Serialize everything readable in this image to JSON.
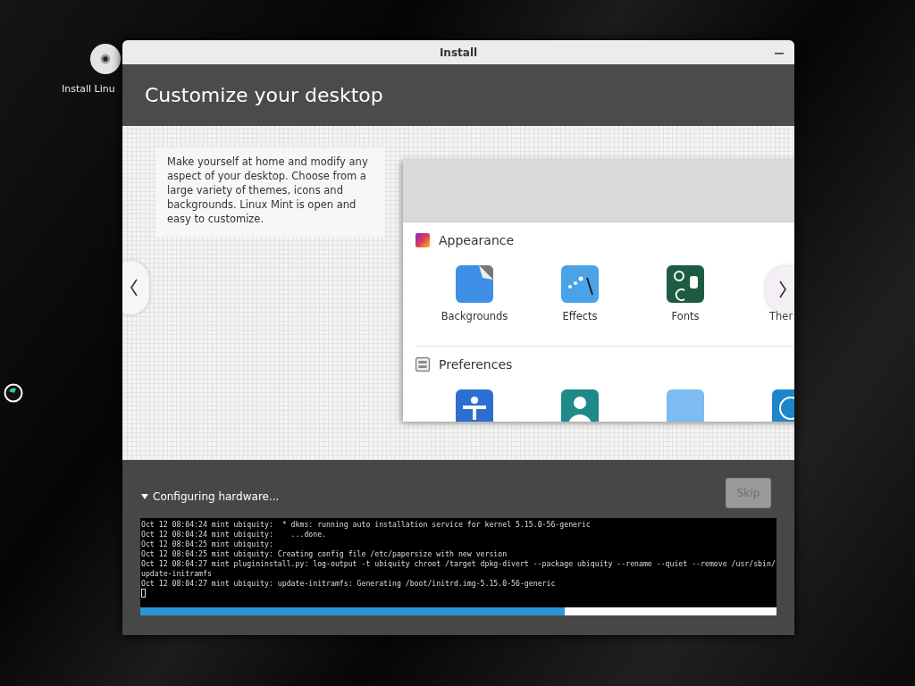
{
  "desktop": {
    "icons": [
      {
        "label": "Install Linu"
      }
    ]
  },
  "window": {
    "title": "Install"
  },
  "header": {
    "title": "Customize your desktop"
  },
  "slide": {
    "description": "Make yourself at home and modify any aspect of your desktop. Choose from a large variety of themes, icons and backgrounds. Linux Mint is open and easy to customize.",
    "preview": {
      "sections": [
        {
          "kind": "appearance",
          "title": "Appearance",
          "items": [
            {
              "kind": "backgrounds",
              "label": "Backgrounds"
            },
            {
              "kind": "effects",
              "label": "Effects"
            },
            {
              "kind": "fonts",
              "label": "Fonts"
            },
            {
              "kind": "covered",
              "label": "Ther"
            }
          ]
        },
        {
          "kind": "preferences",
          "title": "Preferences",
          "items": [
            {
              "kind": "accessibility"
            },
            {
              "kind": "account"
            },
            {
              "kind": "blank"
            },
            {
              "kind": "clock"
            }
          ]
        }
      ]
    }
  },
  "progress": {
    "expanded": true,
    "label": "Configuring hardware...",
    "skip": {
      "label": "Skip",
      "disabled": true
    },
    "log": [
      "Oct 12 08:04:24 mint ubiquity:  * dkms: running auto installation service for kernel 5.15.0-56-generic",
      "Oct 12 08:04:24 mint ubiquity:    ...done.",
      "Oct 12 08:04:25 mint ubiquity:",
      "Oct 12 08:04:25 mint ubiquity: Creating config file /etc/papersize with new version",
      "Oct 12 08:04:27 mint plugininstall.py: log-output -t ubiquity chroot /target dpkg-divert --package ubiquity --rename --quiet --remove /usr/sbin/update-initramfs",
      "Oct 12 08:04:27 mint ubiquity: update-initramfs: Generating /boot/initrd.img-5.15.0-56-generic"
    ],
    "level": 0.667
  }
}
